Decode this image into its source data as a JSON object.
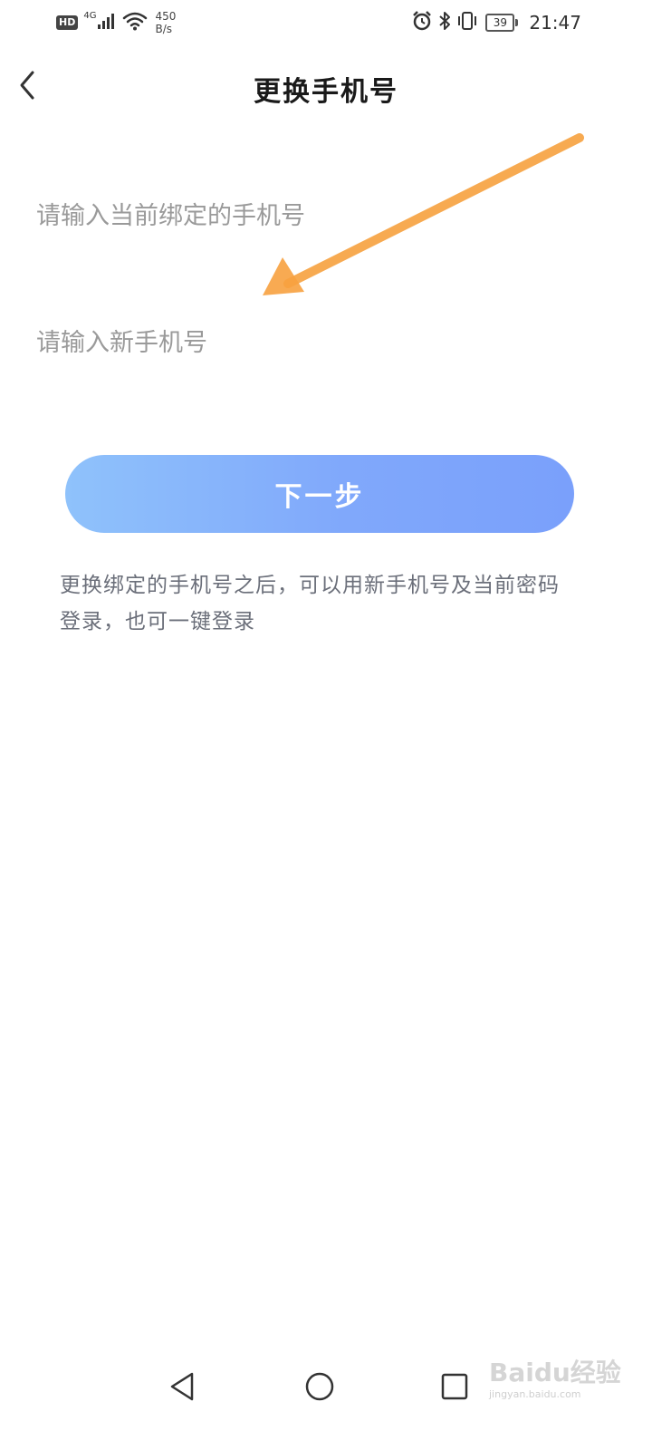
{
  "status_bar": {
    "hd": "HD",
    "network": "4G",
    "speed_value": "450",
    "speed_unit": "B/s",
    "battery": "39",
    "time": "21:47"
  },
  "header": {
    "title": "更换手机号"
  },
  "form": {
    "current_phone_placeholder": "请输入当前绑定的手机号",
    "current_phone_value": "",
    "new_phone_placeholder": "请输入新手机号",
    "new_phone_value": ""
  },
  "actions": {
    "next_label": "下一步"
  },
  "hint": "更换绑定的手机号之后，可以用新手机号及当前密码登录，也可一键登录",
  "watermark": {
    "logo": "Baidu经验",
    "url": "jingyan.baidu.com"
  },
  "colors": {
    "button_gradient_start": "#8fc2fb",
    "button_gradient_end": "#7aa0fb",
    "annotation_arrow": "#f7a13f",
    "placeholder": "#9a9a9a",
    "hint_text": "#6b6f7a"
  },
  "icons": {
    "back": "chevron-left-icon",
    "nav_back": "triangle-back-icon",
    "nav_home": "circle-home-icon",
    "nav_recent": "square-recent-icon"
  }
}
